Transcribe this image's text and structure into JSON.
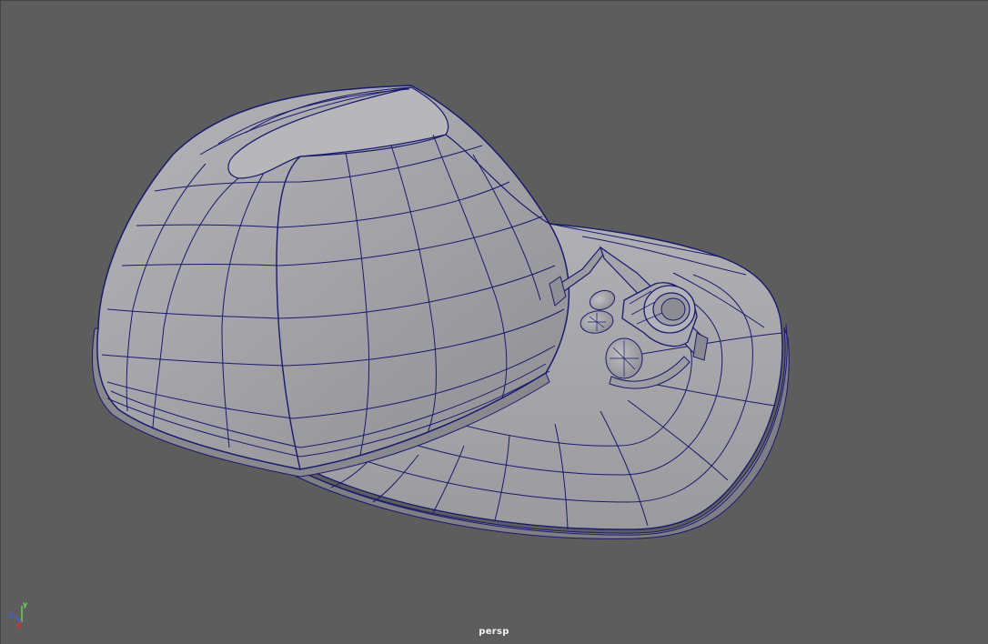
{
  "viewport": {
    "camera_name": "persp",
    "background_color": "#5d5d5d",
    "model_fill_color": "#a3a3a8",
    "wireframe_color": "#1a1a6e"
  },
  "axis_gizmo": {
    "x_label": "x",
    "y_label": "y",
    "z_label": "z",
    "x_color": "#d23232",
    "y_color": "#64dc50",
    "z_color": "#3c64e6"
  },
  "scene": {
    "object": "baseball-cap-with-headlamp",
    "display_mode": "smooth-shade-wireframe-on-shaded"
  }
}
